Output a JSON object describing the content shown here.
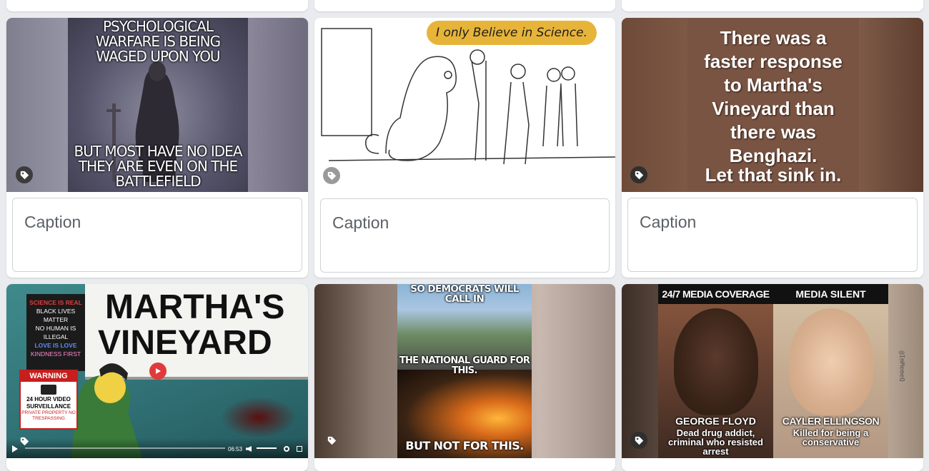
{
  "caption_placeholder": "Caption",
  "colors": {
    "page_bg": "#e9ebee",
    "card_bg": "#ffffff",
    "border": "#cfd3d8"
  },
  "posts": [
    {
      "top_text": "PSYCHOLOGICAL WARFARE IS BEING WAGED UPON YOU",
      "bottom_text": "BUT MOST HAVE NO IDEA THEY ARE EVEN ON THE BATTLEFIELD",
      "tag_icon": "tag-icon"
    },
    {
      "speech_text": "I only Believe in Science.",
      "tag_icon": "tag-icon"
    },
    {
      "line1": "There was a faster response to Martha's Vineyard than there was Benghazi.",
      "line2": "Let that sink in.",
      "tag_icon": "tag-icon"
    },
    {
      "sign_text_1": "MARTHA'S",
      "sign_text_2": "VINEYARD",
      "poster_lines": [
        "SCIENCE IS REAL",
        "BLACK LIVES MATTER",
        "NO HUMAN IS ILLEGAL",
        "LOVE IS LOVE",
        "KINDNESS FIRST"
      ],
      "warning_title": "WARNING",
      "warning_body": "24 HOUR VIDEO SURVEILLANCE",
      "warning_footer": "PRIVATE PROPERTY NO TRESPASSING",
      "video_time": "06:53",
      "tag_icon": "tag-icon"
    },
    {
      "top_text": "SO DEMOCRATS WILL CALL IN",
      "mid_text": "THE NATIONAL GUARD FOR THIS.",
      "bottom_text": "BUT NOT FOR THIS.",
      "tag_icon": "tag-icon"
    },
    {
      "left_header": "24/7 MEDIA COVERAGE",
      "right_header": "MEDIA SILENT",
      "left_name": "GEORGE FLOYD",
      "left_desc": "Dead drug addict, criminal who resisted arrest",
      "right_name": "CAYLER ELLINGSON",
      "right_desc": "Killed for being a conservative",
      "watermark": "@ImMemeQ",
      "tag_icon": "tag-icon"
    }
  ]
}
